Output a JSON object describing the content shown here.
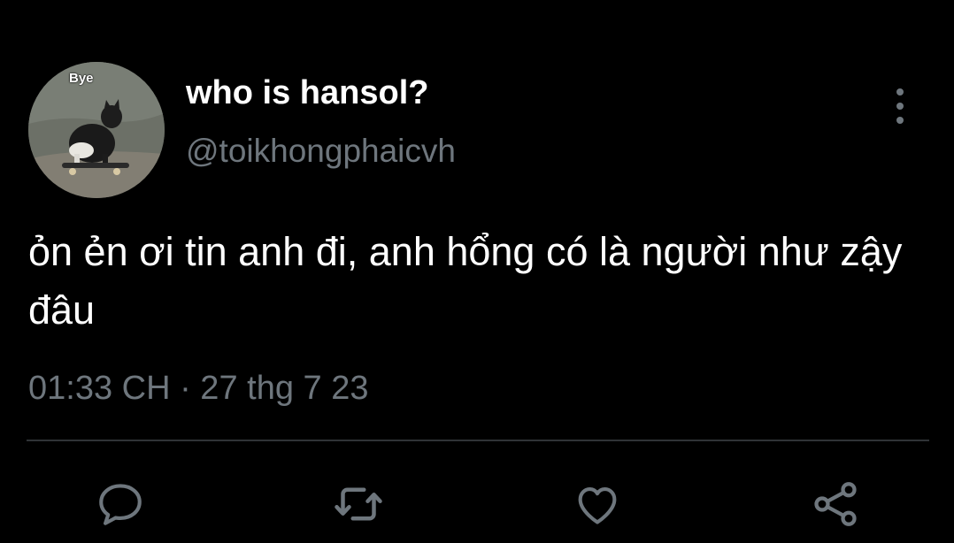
{
  "tweet": {
    "display_name": "who is hansol?",
    "handle": "@toikhongphaicvh",
    "avatar_caption": "Bye",
    "text": "ỏn ẻn ơi tin anh đi, anh hổng có là người như zậy đâu",
    "timestamp": "01:33 CH · 27 thg 7 23"
  },
  "actions": [
    {
      "icon": "reply-icon"
    },
    {
      "icon": "retweet-icon"
    },
    {
      "icon": "like-icon"
    },
    {
      "icon": "share-icon"
    }
  ],
  "menu": {
    "icon": "more-options-icon"
  },
  "colors": {
    "background": "#000000",
    "primary_text": "#ffffff",
    "secondary_text": "#6e767d",
    "divider": "#2f3336"
  }
}
